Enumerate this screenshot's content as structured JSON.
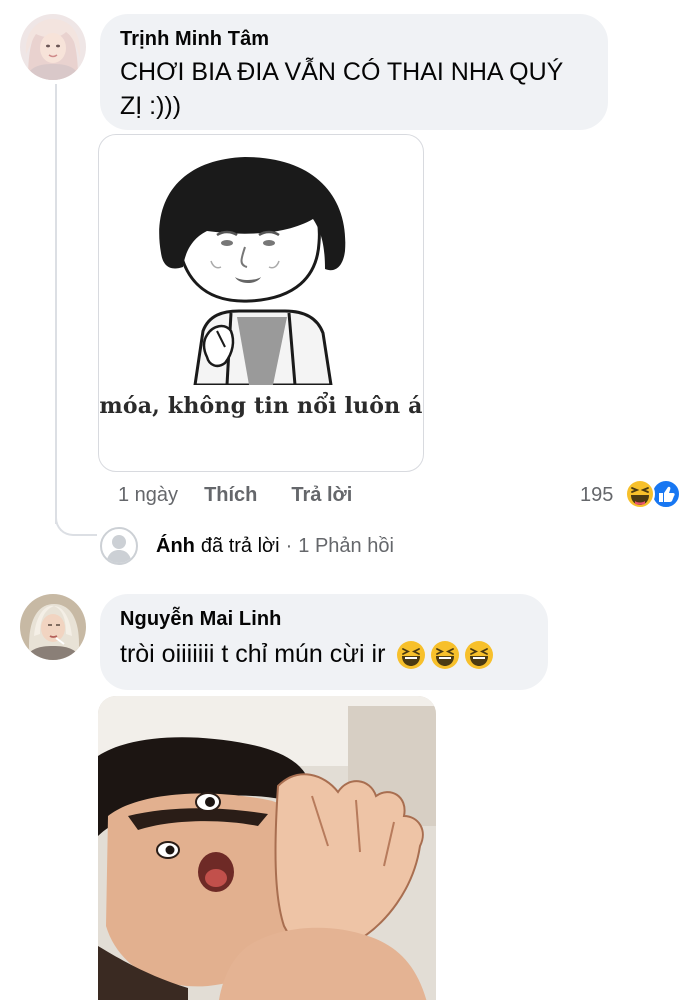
{
  "comments": [
    {
      "author": "Trịnh Minh Tâm",
      "text_line1": "CHƠI BIA ĐIA VẪN CÓ THAI NHA QUÝ",
      "text_line2": "ZỊ :)))",
      "sticker_caption": "móa, không tin nổi luôn á",
      "time": "1 ngày",
      "like_label": "Thích",
      "reply_label": "Trả lời",
      "reaction_count": "195",
      "reaction_icons": [
        "haha-icon",
        "like-icon"
      ],
      "replies": {
        "name": "Ánh",
        "action": "đã trả lời",
        "separator": "·",
        "count_label": "1 Phản hồi"
      }
    },
    {
      "author": "Nguyễn Mai Linh",
      "text": "tròi oiiiiiii t chỉ mún cừi ir",
      "emojis": [
        "laughing-emoji",
        "laughing-emoji",
        "laughing-emoji"
      ]
    }
  ],
  "colors": {
    "bubble": "#f0f2f5",
    "meta_text": "#65676b",
    "like_blue": "#1877f2",
    "haha_yellow": "#f7c02b"
  }
}
